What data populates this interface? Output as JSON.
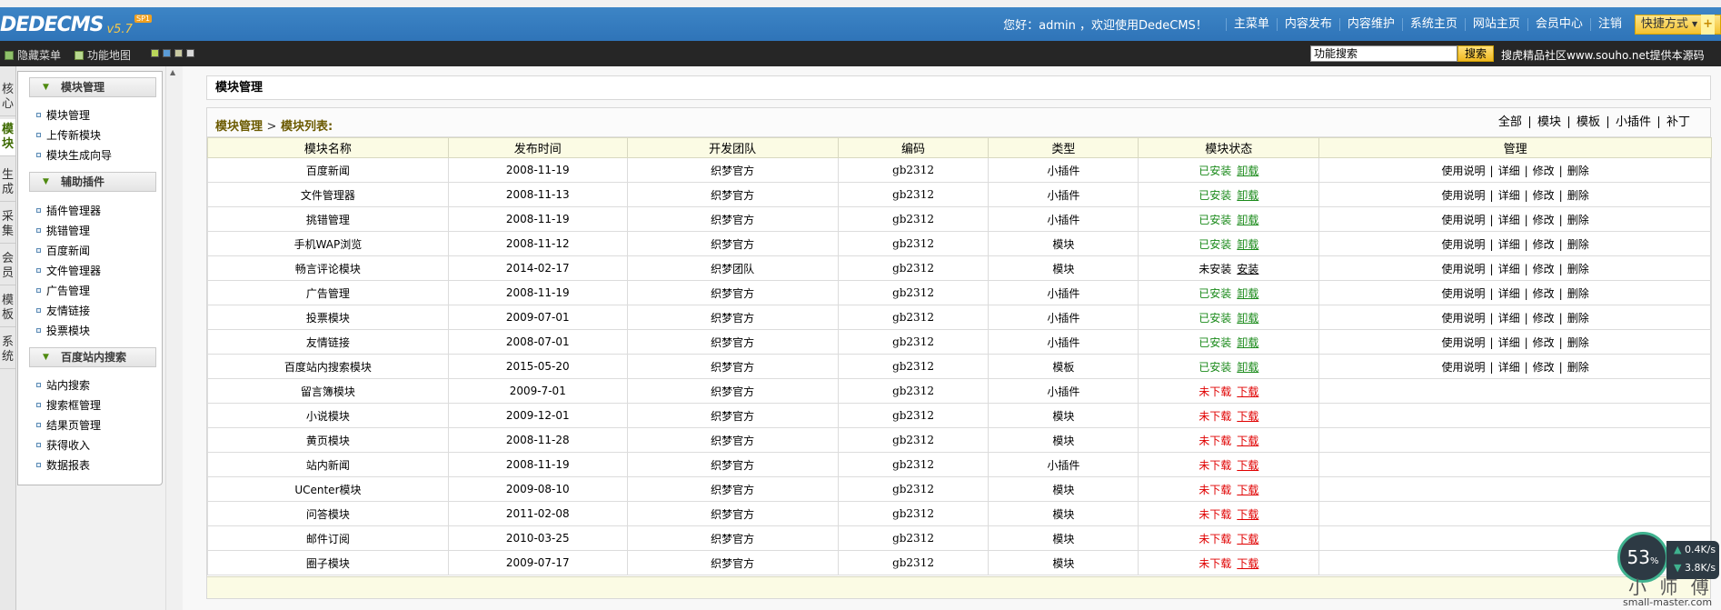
{
  "header": {
    "logo_text": "DEDECMS",
    "logo_version": "v5.7",
    "logo_badge": "SP1",
    "welcome": "您好：admin ，欢迎使用DedeCMS！",
    "nav": [
      "主菜单",
      "内容发布",
      "内容维护",
      "系统主页",
      "网站主页",
      "会员中心",
      "注销"
    ],
    "quick_label": "快捷方式",
    "quick_plus": "+"
  },
  "subbar": {
    "hide_menu": "隐藏菜单",
    "function_map": "功能地图",
    "search_value": "功能搜索",
    "search_button": "搜索",
    "souhu": "搜虎精品社区www.souho.net提供本源码"
  },
  "vtabs": [
    "核心",
    "模块",
    "生成",
    "采集",
    "会员",
    "模板",
    "系统"
  ],
  "menu": {
    "groups": [
      {
        "title": "模块管理",
        "items": [
          "模块管理",
          "上传新模块",
          "模块生成向导"
        ]
      },
      {
        "title": "辅助插件",
        "items": [
          "插件管理器",
          "挑错管理",
          "百度新闻",
          "文件管理器",
          "广告管理",
          "友情链接",
          "投票模块"
        ]
      },
      {
        "title": "百度站内搜索",
        "items": [
          "站内搜索",
          "搜索框管理",
          "结果页管理",
          "获得收入",
          "数据报表"
        ]
      }
    ]
  },
  "main": {
    "title": "模块管理",
    "breadcrumb_home": "模块管理",
    "breadcrumb_sep": ">",
    "breadcrumb_current": "模块列表:",
    "filters": [
      "全部",
      "模块",
      "模板",
      "小插件",
      "补丁"
    ],
    "columns": [
      "模块名称",
      "发布时间",
      "开发团队",
      "编码",
      "类型",
      "模块状态",
      "管理"
    ],
    "manage_links": [
      "使用说明",
      "详细",
      "修改",
      "删除"
    ],
    "rows": [
      {
        "name": "百度新闻",
        "date": "2008-11-19",
        "team": "织梦官方",
        "code": "gb2312",
        "type": "小插件",
        "status": "已安装",
        "action": "卸载",
        "state": "installed"
      },
      {
        "name": "文件管理器",
        "date": "2008-11-13",
        "team": "织梦官方",
        "code": "gb2312",
        "type": "小插件",
        "status": "已安装",
        "action": "卸载",
        "state": "installed"
      },
      {
        "name": "挑错管理",
        "date": "2008-11-19",
        "team": "织梦官方",
        "code": "gb2312",
        "type": "小插件",
        "status": "已安装",
        "action": "卸载",
        "state": "installed"
      },
      {
        "name": "手机WAP浏览",
        "date": "2008-11-12",
        "team": "织梦官方",
        "code": "gb2312",
        "type": "模块",
        "status": "已安装",
        "action": "卸载",
        "state": "installed"
      },
      {
        "name": "畅言评论模块",
        "date": "2014-02-17",
        "team": "织梦团队",
        "code": "gb2312",
        "type": "模块",
        "status": "未安装",
        "action": "安装",
        "state": "uninstalled"
      },
      {
        "name": "广告管理",
        "date": "2008-11-19",
        "team": "织梦官方",
        "code": "gb2312",
        "type": "小插件",
        "status": "已安装",
        "action": "卸载",
        "state": "installed"
      },
      {
        "name": "投票模块",
        "date": "2009-07-01",
        "team": "织梦官方",
        "code": "gb2312",
        "type": "小插件",
        "status": "已安装",
        "action": "卸载",
        "state": "installed"
      },
      {
        "name": "友情链接",
        "date": "2008-07-01",
        "team": "织梦官方",
        "code": "gb2312",
        "type": "小插件",
        "status": "已安装",
        "action": "卸载",
        "state": "installed"
      },
      {
        "name": "百度站内搜索模块",
        "date": "2015-05-20",
        "team": "织梦官方",
        "code": "gb2312",
        "type": "模板",
        "status": "已安装",
        "action": "卸载",
        "state": "installed"
      },
      {
        "name": "留言簿模块",
        "date": "2009-7-01",
        "team": "织梦官方",
        "code": "gb2312",
        "type": "小插件",
        "status": "未下载",
        "action": "下载",
        "state": "notdownloaded"
      },
      {
        "name": "小说模块",
        "date": "2009-12-01",
        "team": "织梦官方",
        "code": "gb2312",
        "type": "模块",
        "status": "未下载",
        "action": "下载",
        "state": "notdownloaded"
      },
      {
        "name": "黄页模块",
        "date": "2008-11-28",
        "team": "织梦官方",
        "code": "gb2312",
        "type": "模块",
        "status": "未下载",
        "action": "下载",
        "state": "notdownloaded"
      },
      {
        "name": "站内新闻",
        "date": "2008-11-19",
        "team": "织梦官方",
        "code": "gb2312",
        "type": "小插件",
        "status": "未下载",
        "action": "下载",
        "state": "notdownloaded"
      },
      {
        "name": "UCenter模块",
        "date": "2009-08-10",
        "team": "织梦官方",
        "code": "gb2312",
        "type": "模块",
        "status": "未下载",
        "action": "下载",
        "state": "notdownloaded"
      },
      {
        "name": "问答模块",
        "date": "2011-02-08",
        "team": "织梦官方",
        "code": "gb2312",
        "type": "模块",
        "status": "未下载",
        "action": "下载",
        "state": "notdownloaded"
      },
      {
        "name": "邮件订阅",
        "date": "2010-03-25",
        "team": "织梦官方",
        "code": "gb2312",
        "type": "模块",
        "status": "未下载",
        "action": "下载",
        "state": "notdownloaded"
      },
      {
        "name": "圈子模块",
        "date": "2009-07-17",
        "team": "织梦官方",
        "code": "gb2312",
        "type": "模块",
        "status": "未下载",
        "action": "下载",
        "state": "notdownloaded"
      }
    ]
  },
  "speed_widget": {
    "percent": "53",
    "percent_unit": "%",
    "up": "0.4K/s",
    "down": "3.8K/s"
  },
  "watermark": {
    "name": "小 师 傅",
    "site": "small-master.com"
  },
  "colors": {
    "header_blue": "#3079c2",
    "subbar_black": "#262626",
    "installed_green": "#1a8a1a",
    "notdownloaded_red": "#e00000",
    "table_header_bg": "#fbfbe4"
  }
}
